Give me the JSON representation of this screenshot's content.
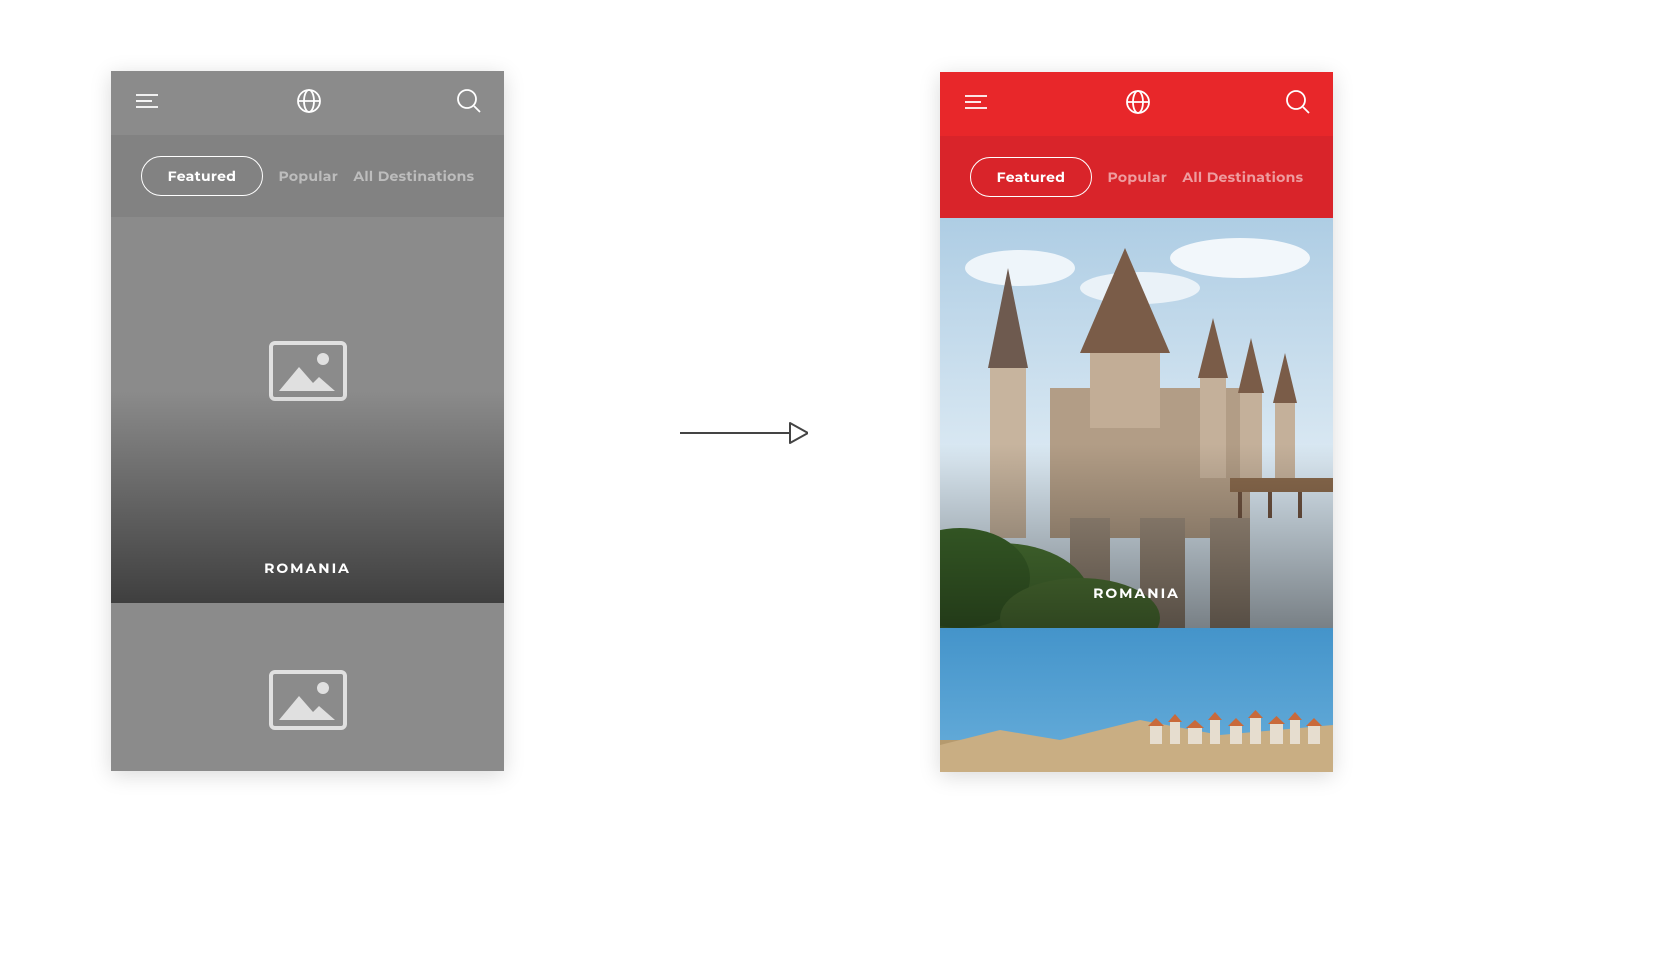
{
  "tabs": {
    "featured": "Featured",
    "popular": "Popular",
    "all": "All Destinations"
  },
  "cards": {
    "first_label": "ROMANIA"
  },
  "colors": {
    "brand_red": "#e8272a",
    "brand_red_dark": "#d9242a",
    "wireframe_gray": "#8b8b8b"
  }
}
